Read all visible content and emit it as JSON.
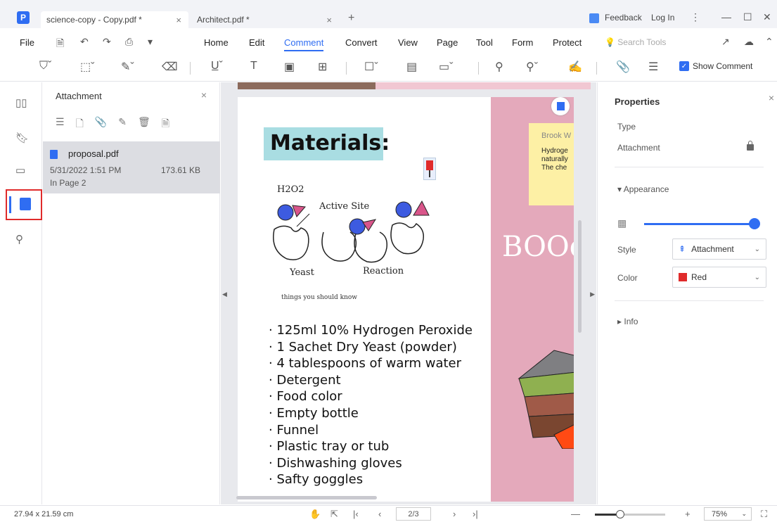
{
  "tabs": [
    {
      "title": "science-copy - Copy.pdf *",
      "close": "×"
    },
    {
      "title": "Architect.pdf *",
      "close": "×"
    }
  ],
  "titlebar": {
    "feedback": "Feedback",
    "login": "Log In",
    "more": "⋮",
    "minimize": "—",
    "maximize": "☐",
    "close": "✕",
    "new_tab": "+"
  },
  "menu": {
    "file": "File",
    "items": [
      "Home",
      "Edit",
      "Comment",
      "Convert",
      "View",
      "Page",
      "Tool",
      "Form",
      "Protect"
    ],
    "active": "Comment",
    "search_placeholder": "Search Tools"
  },
  "toolbar": {
    "show_comment": "Show Comment",
    "show_comment_checked": true
  },
  "attachment_panel": {
    "title": "Attachment",
    "close": "×",
    "file": {
      "name": "proposal.pdf",
      "date": "5/31/2022 1:51 PM",
      "size": "173.61 KB",
      "page": "In Page 2"
    }
  },
  "document": {
    "title": "Materials:",
    "handwritten": {
      "h2o2": "H2O2",
      "active_site": "Active Site",
      "yeast": "Yeast",
      "reaction": "Reaction"
    },
    "note": "things you should know",
    "materials": [
      "125ml 10% Hydrogen Peroxide",
      "1 Sachet Dry Yeast (powder)",
      "4 tablespoons of warm water",
      "Detergent",
      "Food color",
      "Empty bottle",
      "Funnel",
      "Plastic tray or tub",
      "Dishwashing gloves",
      "Safty goggles"
    ],
    "sticky": {
      "author": "Brook W",
      "text": "Hydroge\nnaturally\nThe che"
    },
    "side_title": "BOOd"
  },
  "properties": {
    "title": "Properties",
    "close": "×",
    "type_label": "Type",
    "type_value": "Attachment",
    "appearance": "Appearance",
    "opacity": 1.0,
    "style_label": "Style",
    "style_value": "Attachment",
    "color_label": "Color",
    "color_value": "Red",
    "color_hex": "#e02b2b",
    "info": "Info"
  },
  "status": {
    "dimensions": "27.94 x 21.59 cm",
    "page": "2/3",
    "zoom": "75%",
    "zoom_level": 0.36
  },
  "colors": {
    "accent": "#2f6df2",
    "highlight_red": "#e02b2b",
    "pink_page": "#e4a9bb",
    "title_box": "#a9dde2"
  }
}
